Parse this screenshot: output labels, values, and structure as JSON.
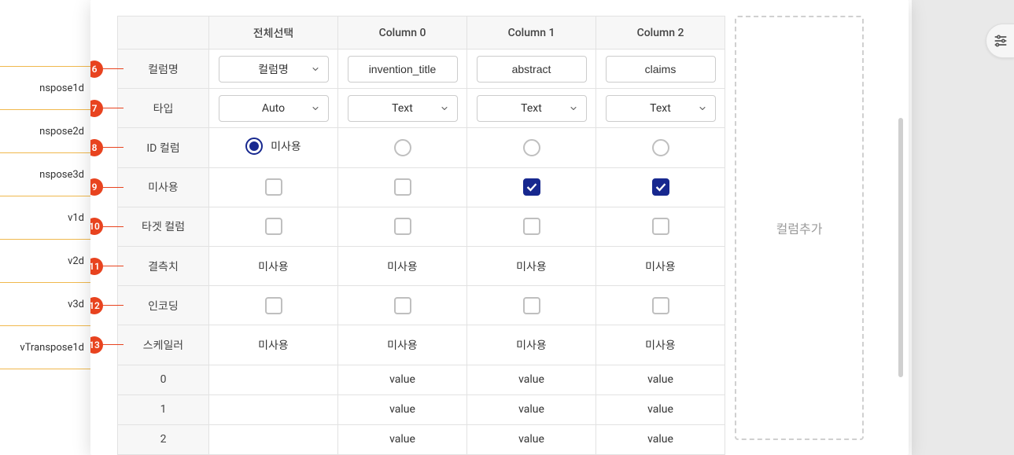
{
  "background_left_items": [
    "",
    "nspose1d",
    "nspose2d",
    "nspose3d",
    "v1d",
    "v2d",
    "v3d",
    "vTranspose1d"
  ],
  "fab_icon": "sliders-icon",
  "table": {
    "head": {
      "rowhdr": "",
      "columns": [
        "전체선택",
        "Column 0",
        "Column 1",
        "Column 2"
      ]
    },
    "rows": [
      {
        "callout": 6,
        "label": "컬럼명",
        "kind": "name",
        "cells": [
          {
            "type": "select",
            "value": "컬럼명"
          },
          {
            "type": "input",
            "value": "invention_title"
          },
          {
            "type": "input",
            "value": "abstract"
          },
          {
            "type": "input",
            "value": "claims"
          }
        ]
      },
      {
        "callout": 7,
        "label": "타입",
        "kind": "type",
        "cells": [
          {
            "type": "select",
            "value": "Auto"
          },
          {
            "type": "select",
            "value": "Text"
          },
          {
            "type": "select",
            "value": "Text"
          },
          {
            "type": "select",
            "value": "Text"
          }
        ]
      },
      {
        "callout": 8,
        "label": "ID 컬럼",
        "kind": "idcol",
        "cells": [
          {
            "type": "radio-label",
            "checked": true,
            "text": "미사용"
          },
          {
            "type": "radio",
            "checked": false
          },
          {
            "type": "radio",
            "checked": false
          },
          {
            "type": "radio",
            "checked": false
          }
        ]
      },
      {
        "callout": 9,
        "label": "미사용",
        "kind": "unused",
        "cells": [
          {
            "type": "check",
            "checked": false
          },
          {
            "type": "check",
            "checked": false
          },
          {
            "type": "check",
            "checked": true
          },
          {
            "type": "check",
            "checked": true
          }
        ]
      },
      {
        "callout": 10,
        "label": "타겟 컬럼",
        "kind": "target",
        "cells": [
          {
            "type": "check",
            "checked": false
          },
          {
            "type": "check",
            "checked": false
          },
          {
            "type": "check",
            "checked": false
          },
          {
            "type": "check",
            "checked": false
          }
        ]
      },
      {
        "callout": 11,
        "label": "결측치",
        "kind": "missing",
        "cells": [
          {
            "type": "text",
            "value": "미사용"
          },
          {
            "type": "text",
            "value": "미사용"
          },
          {
            "type": "text",
            "value": "미사용"
          },
          {
            "type": "text",
            "value": "미사용"
          }
        ]
      },
      {
        "callout": 12,
        "label": "인코딩",
        "kind": "encoding",
        "cells": [
          {
            "type": "check",
            "checked": false
          },
          {
            "type": "check",
            "checked": false
          },
          {
            "type": "check",
            "checked": false
          },
          {
            "type": "check",
            "checked": false
          }
        ]
      },
      {
        "callout": 13,
        "label": "스케일러",
        "kind": "scaler",
        "cells": [
          {
            "type": "text",
            "value": "미사용"
          },
          {
            "type": "text",
            "value": "미사용"
          },
          {
            "type": "text",
            "value": "미사용"
          },
          {
            "type": "text",
            "value": "미사용"
          }
        ]
      }
    ],
    "data_rows": [
      {
        "idx": "0",
        "cells": [
          "",
          "value",
          "value",
          "value"
        ]
      },
      {
        "idx": "1",
        "cells": [
          "",
          "value",
          "value",
          "value"
        ]
      },
      {
        "idx": "2",
        "cells": [
          "",
          "value",
          "value",
          "value"
        ]
      }
    ]
  },
  "add_column_label": "컬럼추가"
}
